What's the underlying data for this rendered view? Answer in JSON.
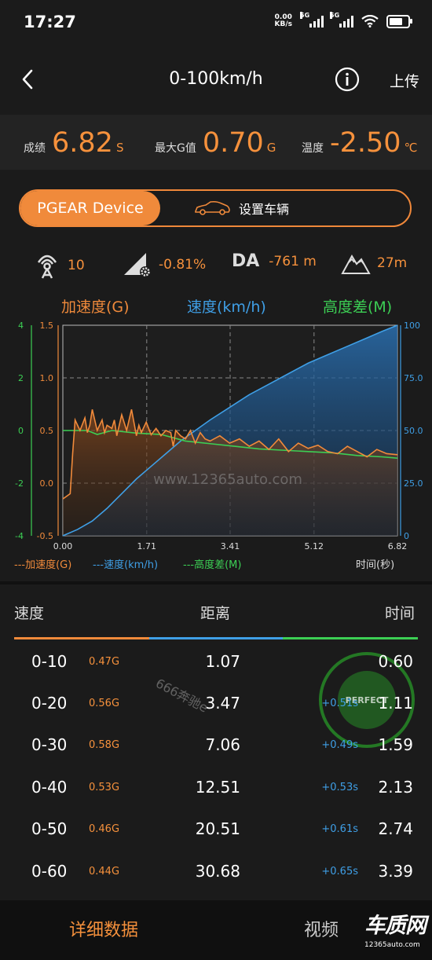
{
  "status": {
    "time": "17:27",
    "net_speed": "0.00",
    "net_unit": "KB/s",
    "sim1": "5G",
    "sim2": "5G",
    "battery_level": 0.8
  },
  "header": {
    "title": "0-100km/h",
    "upload": "上传"
  },
  "results": {
    "score_label": "成绩",
    "score_value": "6.82",
    "score_unit": "S",
    "maxg_label": "最大G值",
    "maxg_value": "0.70",
    "maxg_unit": "G",
    "temp_label": "温度",
    "temp_value": "-2.50",
    "temp_unit": "℃"
  },
  "segment": {
    "device": "PGEAR Device",
    "vehicle": "设置车辆"
  },
  "sensors": {
    "satellites": "10",
    "slope": "-0.81%",
    "da_label": "DA",
    "da_value": "-761 m",
    "altitude": "27m"
  },
  "chart_data": {
    "type": "line",
    "series_titles": [
      "加速度(G)",
      "速度(km/h)",
      "高度差(M)"
    ],
    "legend": [
      "---加速度(G)",
      "---速度(km/h)",
      "---高度差(M)"
    ],
    "xlabel": "时间(秒)",
    "x_ticks": [
      "0.00",
      "1.71",
      "3.41",
      "5.12",
      "6.82"
    ],
    "accel_ticks": [
      "1.5",
      "1.0",
      "0.5",
      "0.0",
      "-0.5"
    ],
    "altitude_ticks": [
      "4",
      "2",
      "0",
      "-2",
      "-4"
    ],
    "speed_ticks": [
      "100",
      "75.0",
      "50.0",
      "25.0",
      "0"
    ],
    "xlim": [
      0,
      6.82
    ],
    "accel_ylim": [
      -0.5,
      1.5
    ],
    "speed_ylim": [
      0,
      100
    ],
    "altitude_ylim": [
      -4,
      4
    ],
    "series": [
      {
        "name": "加速度(G)",
        "color": "#f08a3b",
        "x": [
          0,
          0.15,
          0.2,
          0.25,
          0.35,
          0.45,
          0.5,
          0.55,
          0.6,
          0.7,
          0.8,
          0.85,
          0.9,
          1.0,
          1.05,
          1.1,
          1.2,
          1.3,
          1.4,
          1.5,
          1.55,
          1.6,
          1.7,
          1.8,
          1.9,
          2.0,
          2.1,
          2.2,
          2.25,
          2.3,
          2.4,
          2.5,
          2.6,
          2.7,
          2.8,
          2.9,
          3.0,
          3.2,
          3.4,
          3.6,
          3.8,
          4.0,
          4.2,
          4.4,
          4.6,
          4.8,
          5.0,
          5.2,
          5.4,
          5.6,
          5.8,
          6.0,
          6.2,
          6.4,
          6.6,
          6.82
        ],
        "y": [
          -0.15,
          -0.1,
          0.28,
          0.6,
          0.5,
          0.62,
          0.48,
          0.55,
          0.7,
          0.5,
          0.6,
          0.48,
          0.55,
          0.52,
          0.6,
          0.45,
          0.65,
          0.5,
          0.7,
          0.45,
          0.55,
          0.48,
          0.58,
          0.46,
          0.52,
          0.45,
          0.5,
          0.48,
          0.35,
          0.5,
          0.45,
          0.42,
          0.5,
          0.38,
          0.48,
          0.42,
          0.4,
          0.45,
          0.38,
          0.42,
          0.35,
          0.4,
          0.32,
          0.42,
          0.3,
          0.38,
          0.33,
          0.36,
          0.3,
          0.28,
          0.35,
          0.3,
          0.25,
          0.32,
          0.28,
          0.27
        ]
      },
      {
        "name": "速度(km/h)",
        "color": "#3f9fe6",
        "x": [
          0,
          0.3,
          0.6,
          0.9,
          1.2,
          1.5,
          1.8,
          2.1,
          2.4,
          2.7,
          3.0,
          3.4,
          3.8,
          4.2,
          4.6,
          5.0,
          5.4,
          5.8,
          6.2,
          6.5,
          6.82
        ],
        "y": [
          0,
          3,
          7,
          13,
          20,
          27,
          33,
          39,
          45,
          50,
          55,
          61,
          67,
          72,
          77,
          82,
          86,
          90,
          94,
          97,
          100
        ]
      },
      {
        "name": "高度差(M)",
        "color": "#3ccf54",
        "x": [
          0,
          0.5,
          0.7,
          1.0,
          1.5,
          2.0,
          2.5,
          3.0,
          3.5,
          4.0,
          4.5,
          5.0,
          5.5,
          6.0,
          6.5,
          6.82
        ],
        "y": [
          0,
          0,
          -0.15,
          0,
          -0.1,
          -0.15,
          -0.4,
          -0.5,
          -0.6,
          -0.7,
          -0.75,
          -0.8,
          -0.85,
          -0.95,
          -1.0,
          -1.05
        ]
      }
    ]
  },
  "table": {
    "col_speed": "速度",
    "col_distance": "距离",
    "col_time": "时间",
    "rows": [
      {
        "range": "0-10",
        "g": "0.47G",
        "distance": "1.07",
        "delta": "",
        "time": "0.60"
      },
      {
        "range": "0-20",
        "g": "0.56G",
        "distance": "3.47",
        "delta": "+0.51s",
        "time": "1.11"
      },
      {
        "range": "0-30",
        "g": "0.58G",
        "distance": "7.06",
        "delta": "+0.49s",
        "time": "1.59"
      },
      {
        "range": "0-40",
        "g": "0.53G",
        "distance": "12.51",
        "delta": "+0.53s",
        "time": "2.13"
      },
      {
        "range": "0-50",
        "g": "0.46G",
        "distance": "20.51",
        "delta": "+0.61s",
        "time": "2.74"
      },
      {
        "range": "0-60",
        "g": "0.44G",
        "distance": "30.68",
        "delta": "+0.65s",
        "time": "3.39"
      }
    ]
  },
  "watermarks": {
    "chart": "www.12365auto.com",
    "user": "666奔驰e",
    "stamp": "PERFECT"
  },
  "bottom": {
    "detail": "详细数据",
    "video": "视频",
    "logo_text": "车质网",
    "logo_url": "12365auto.com"
  },
  "colors": {
    "accent": "#f08a3b",
    "speed": "#3f9fe6",
    "altitude": "#3ccf54"
  }
}
